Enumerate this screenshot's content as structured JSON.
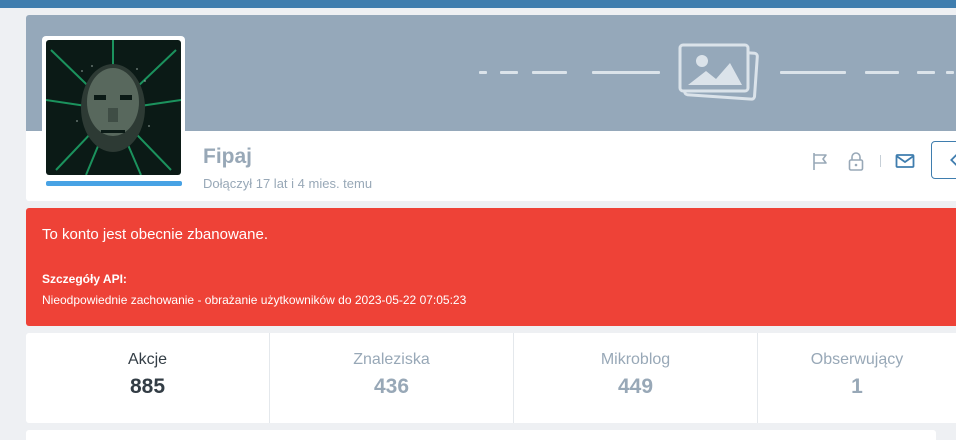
{
  "profile": {
    "username": "Fipaj",
    "joined": "Dołączył 17 lat i 4 mies. temu",
    "icons": {
      "cover": "image-placeholder-icon",
      "report": "flag-icon",
      "block": "lock-icon",
      "message": "mail-icon",
      "more": "chevron-left-icon"
    }
  },
  "ban": {
    "title": "To konto jest obecnie zbanowane.",
    "details_label": "Szczegóły API:",
    "details_value": "Nieodpowiednie zachowanie - obrażanie użytkowników do 2023-05-22 07:05:23"
  },
  "stats": [
    {
      "label": "Akcje",
      "value": "885"
    },
    {
      "label": "Znaleziska",
      "value": "436"
    },
    {
      "label": "Mikroblog",
      "value": "449"
    },
    {
      "label": "Obserwujący",
      "value": "1"
    }
  ],
  "colors": {
    "topbar": "#3f7dae",
    "cover": "#95a8ba",
    "ban_background": "#ee4237",
    "accent": "#48a2e4",
    "muted_text": "#98a8b7"
  }
}
